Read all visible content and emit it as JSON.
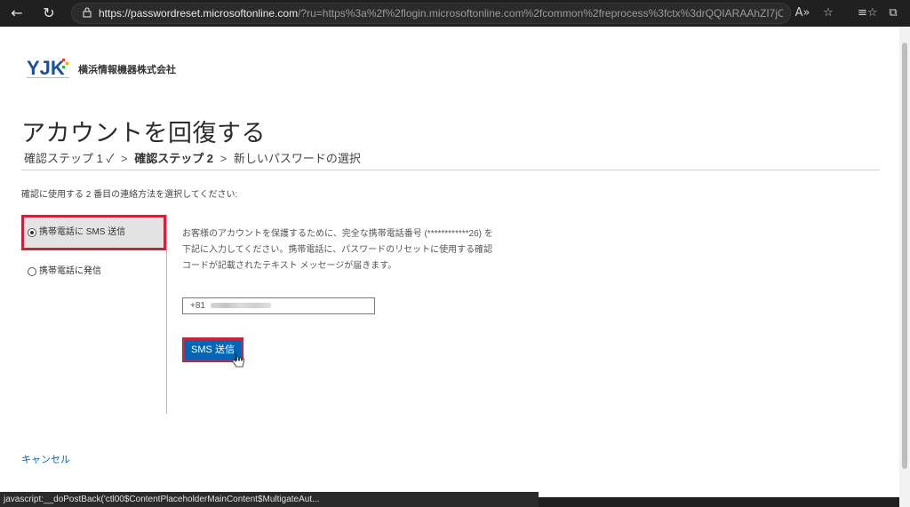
{
  "browser": {
    "url_host": "https://passwordreset.microsoftonline.com",
    "url_rest": "/?ru=https%3a%2f%2flogin.microsoftonline.com%2fcommon%2freprocess%3fctx%3drQQIARAAhZI7jONkFI...",
    "status_text": "javascript:__doPostBack('ctl00$ContentPlaceholderMainContent$MultigateAut..."
  },
  "header": {
    "logo_text": "YJK",
    "company_name": "横浜情報機器株式会社"
  },
  "page_title": "アカウントを回復する",
  "steps": {
    "step1": "確認ステップ 1 ✓",
    "step2": "確認ステップ 2",
    "step3": "新しいパスワードの選択",
    "separator": ">"
  },
  "instruction": "確認に使用する 2 番目の連絡方法を選択してください:",
  "options": [
    {
      "label": "携帯電話に SMS 送信",
      "selected": true
    },
    {
      "label": "携帯電話に発信",
      "selected": false
    }
  ],
  "description": "お客様のアカウントを保護するために、完全な携帯電話番号 (************26) を下記に入力してください。携帯電話に、パスワードのリセットに使用する確認コードが記載されたテキスト メッセージが届きます。",
  "phone": {
    "prefix": "+81"
  },
  "sms_button_label": "SMS 送信",
  "cancel_label": "キャンセル",
  "colors": {
    "accent": "#0067b8",
    "highlight": "#d0203a"
  }
}
